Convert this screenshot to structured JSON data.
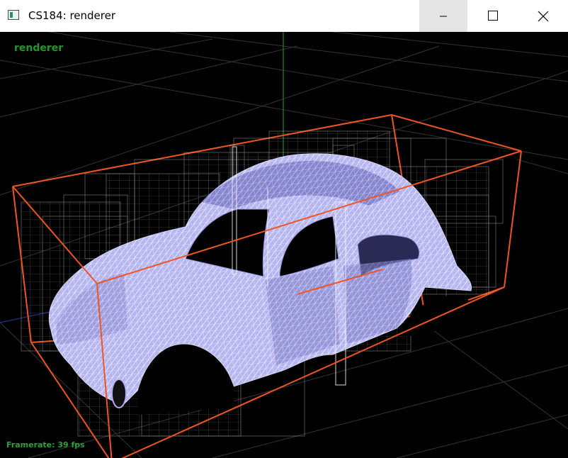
{
  "window": {
    "title": "CS184: renderer",
    "controls": {
      "minimize": "minimize",
      "maximize": "maximize",
      "close": "close"
    }
  },
  "viewport": {
    "label": "renderer",
    "framerate": "Framerate: 39 fps"
  },
  "colors": {
    "background": "#000000",
    "grid": "#3a3a3a",
    "y_axis": "#1a8c2a",
    "bounding_box": "#ee5522",
    "mesh_fill": "#b7b7f2",
    "mesh_wire": "#e6e6f0",
    "bvh_boxes": "#bfbfbf",
    "label_green": "#1f9a2a"
  }
}
